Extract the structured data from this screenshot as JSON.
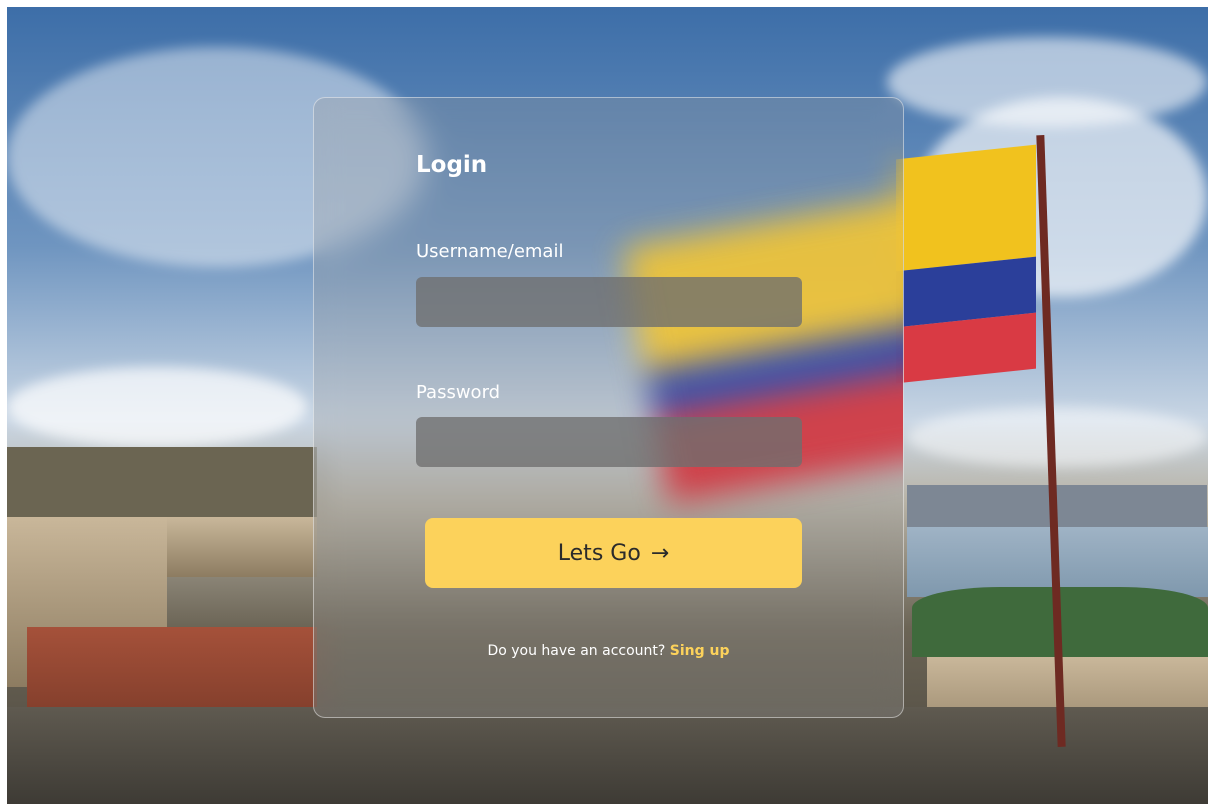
{
  "login": {
    "title": "Login",
    "username_label": "Username/email",
    "username_value": "",
    "password_label": "Password",
    "password_value": "",
    "submit_label": "Lets Go",
    "submit_icon": "arrow-right-icon",
    "footer_text": "Do you have an account?",
    "signup_link": "Sing up"
  },
  "colors": {
    "accent": "#fcd25b",
    "card_bg": "rgba(150,150,150,0.28)",
    "input_bg": "rgba(110,110,110,0.78)"
  }
}
